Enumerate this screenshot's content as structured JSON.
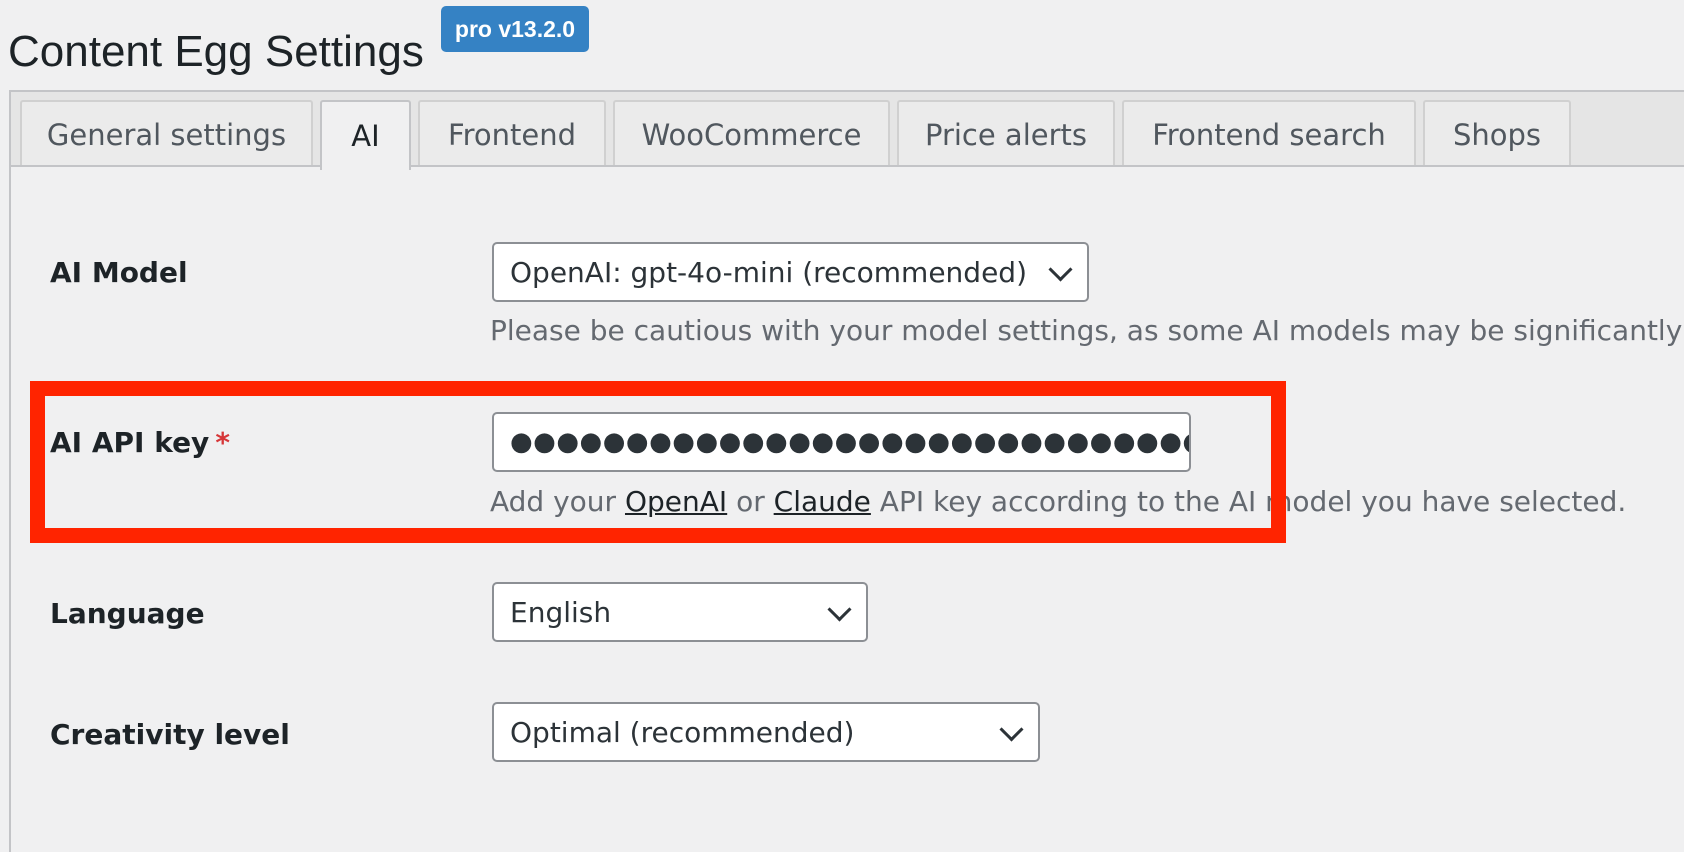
{
  "header": {
    "title": "Content Egg Settings",
    "version_badge": "pro v13.2.0"
  },
  "tabs": [
    {
      "label": "General settings",
      "active": false
    },
    {
      "label": "AI",
      "active": true
    },
    {
      "label": "Frontend",
      "active": false
    },
    {
      "label": "WooCommerce",
      "active": false
    },
    {
      "label": "Price alerts",
      "active": false
    },
    {
      "label": "Frontend search",
      "active": false
    },
    {
      "label": "Shops",
      "active": false
    }
  ],
  "settings": {
    "ai_model": {
      "label": "AI Model",
      "selected": "OpenAI: gpt-4o-mini (recommended)",
      "description": "Please be cautious with your model settings, as some AI models may be significantly"
    },
    "api_key": {
      "label": "AI API key",
      "required_mark": "*",
      "masked_value": "●●●●●●●●●●●●●●●●●●●●●●●●●●●●●●●●●●●●●●●●●●●●",
      "description_prefix": "Add your",
      "link_openai": "OpenAI",
      "description_or": "or",
      "link_claude": "Claude",
      "description_suffix": "API key according to the AI model you have selected."
    },
    "language": {
      "label": "Language",
      "selected": "English"
    },
    "creativity": {
      "label": "Creativity level",
      "selected": "Optimal (recommended)"
    }
  },
  "colors": {
    "accent": "#3582c4",
    "highlight": "#ff2400",
    "required": "#d63638"
  },
  "icons": [
    "chevron-down-icon"
  ]
}
